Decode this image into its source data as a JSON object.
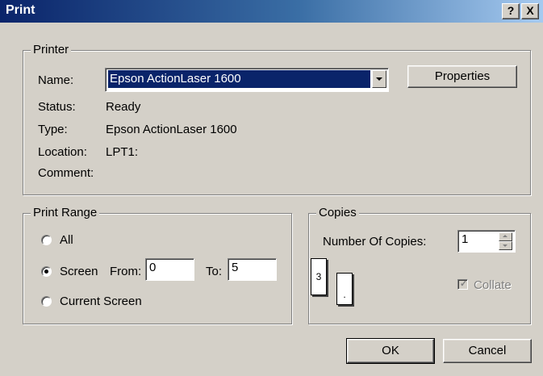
{
  "window": {
    "title": "Print",
    "help_button": "?",
    "close_button": "X"
  },
  "printer": {
    "group_label": "Printer",
    "name_label": "Name:",
    "name_value": "Epson ActionLaser 1600",
    "properties_button": "Properties",
    "status_label": "Status:",
    "status_value": "Ready",
    "type_label": "Type:",
    "type_value": "Epson ActionLaser 1600",
    "location_label": "Location:",
    "location_value": "LPT1:",
    "comment_label": "Comment:",
    "comment_value": ""
  },
  "print_range": {
    "group_label": "Print Range",
    "all_label": "All",
    "screen_label": "Screen",
    "from_label": "From:",
    "from_value": "0",
    "to_label": "To:",
    "to_value": "5",
    "current_screen_label": "Current Screen",
    "selected": "screen"
  },
  "copies": {
    "group_label": "Copies",
    "number_label": "Number Of Copies:",
    "number_value": "1",
    "preview_page_label": "3",
    "collate_label": "Collate",
    "collate_checked": true,
    "collate_enabled": false
  },
  "footer": {
    "ok_button": "OK",
    "cancel_button": "Cancel"
  }
}
